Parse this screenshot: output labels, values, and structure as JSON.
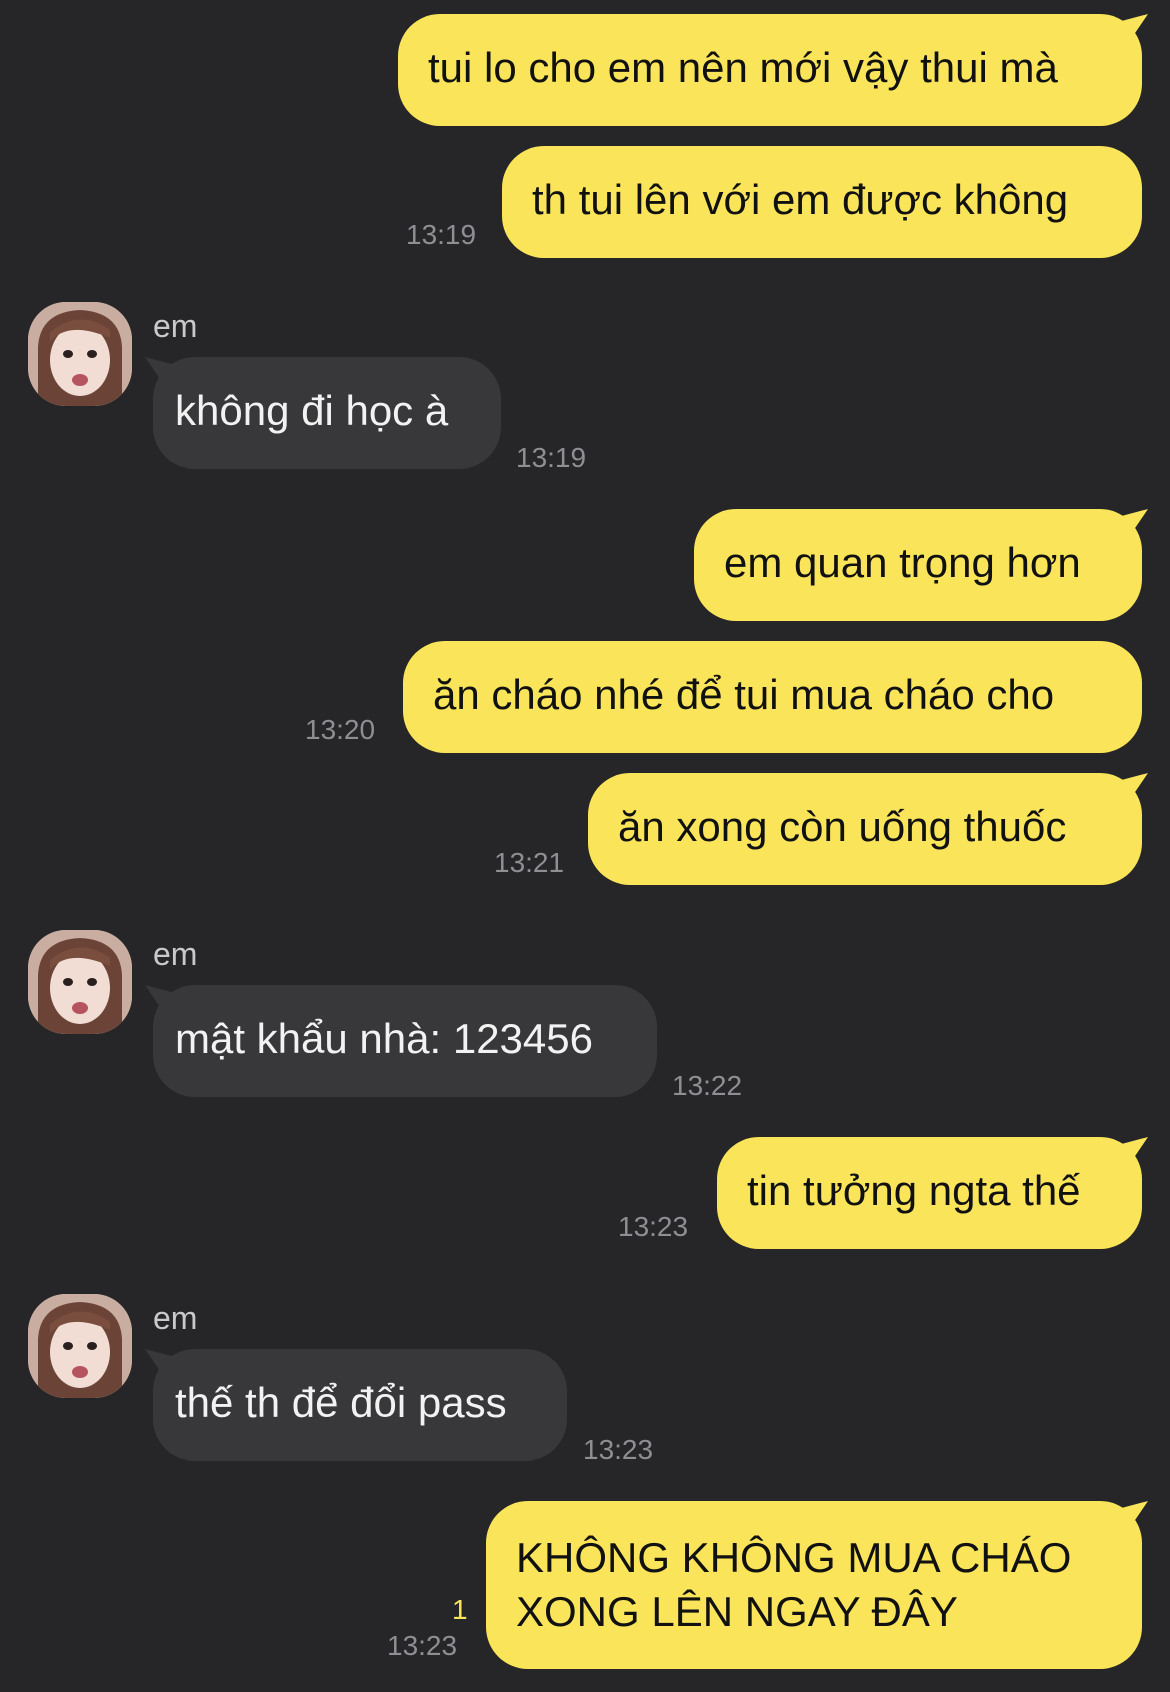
{
  "contact": {
    "name": "em",
    "avatar_icon": "profile-photo-icon"
  },
  "colors": {
    "background": "#262628",
    "outgoing_bubble": "#fae55a",
    "incoming_bubble": "#38383b",
    "timestamp": "#8e8e93",
    "unread_count": "#fae55a"
  },
  "messages": [
    {
      "direction": "out",
      "text": "tui lo cho em nên mới vậy thui mà",
      "time": ""
    },
    {
      "direction": "out",
      "text": "th tui lên với em được không",
      "time": "13:19"
    },
    {
      "direction": "in",
      "sender": "em",
      "text": "không đi học à",
      "time": "13:19"
    },
    {
      "direction": "out",
      "text": "em quan trọng hơn",
      "time": ""
    },
    {
      "direction": "out",
      "text": "ăn cháo nhé để tui mua cháo cho",
      "time": "13:20"
    },
    {
      "direction": "out",
      "text": "ăn xong còn uống thuốc",
      "time": "13:21"
    },
    {
      "direction": "in",
      "sender": "em",
      "text": "mật khẩu nhà: 123456",
      "time": "13:22"
    },
    {
      "direction": "out",
      "text": "tin tưởng ngta thế",
      "time": "13:23"
    },
    {
      "direction": "in",
      "sender": "em",
      "text": "thế th để đổi pass",
      "time": "13:23"
    },
    {
      "direction": "out",
      "text": "KHÔNG KHÔNG MUA CHÁO XONG LÊN NGAY ĐÂY",
      "time": "13:23",
      "unread": "1"
    }
  ]
}
